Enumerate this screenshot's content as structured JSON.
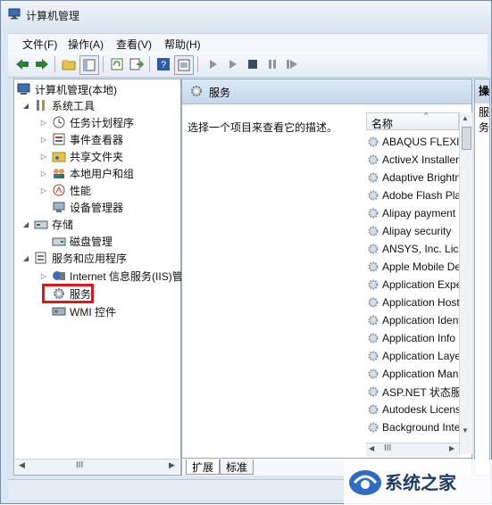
{
  "window": {
    "title": "计算机管理"
  },
  "menu": [
    "文件(F)",
    "操作(A)",
    "查看(V)",
    "帮助(H)"
  ],
  "toolbar_icons": [
    "back-arrow-icon",
    "forward-arrow-icon",
    "up-folder-icon",
    "show-hide-tree-icon",
    "refresh-icon",
    "export-list-icon",
    "help-icon",
    "properties-icon",
    "start-service-icon",
    "start-icon",
    "stop-service-icon",
    "pause-service-icon",
    "restart-service-icon"
  ],
  "tree": {
    "root": "计算机管理(本地)",
    "system_tools": "系统工具",
    "task_scheduler": "任务计划程序",
    "event_viewer": "事件查看器",
    "shared_folders": "共享文件夹",
    "local_users": "本地用户和组",
    "performance": "性能",
    "device_manager": "设备管理器",
    "storage": "存储",
    "disk_management": "磁盘管理",
    "services_apps": "服务和应用程序",
    "iis": "Internet 信息服务(IIS)管",
    "services": "服务",
    "wmi": "WMI 控件",
    "scroll_grip": "III"
  },
  "main": {
    "header_title": "服务",
    "description": "选择一个项目来查看它的描述。",
    "column_name": "名称",
    "services": [
      "ABAQUS FLEXlm",
      "ActiveX Installer",
      "Adaptive Brightness",
      "Adobe Flash Player",
      "Alipay payment",
      "Alipay security",
      "ANSYS, Inc. License",
      "Apple Mobile Device",
      "Application Experience",
      "Application Host",
      "Application Identity",
      "Application Info",
      "Application Layer",
      "Application Management",
      "ASP.NET 状态服务",
      "Autodesk Licensing",
      "Background Intelligent"
    ],
    "scroll_grip": "III",
    "tabs": [
      "扩展",
      "标准"
    ]
  },
  "actions": {
    "header": "操作",
    "item": "服务"
  },
  "watermark": {
    "text": "系统之家"
  },
  "colors": {
    "highlight": "#e0161e",
    "header_blue": "#c6d7ea"
  }
}
